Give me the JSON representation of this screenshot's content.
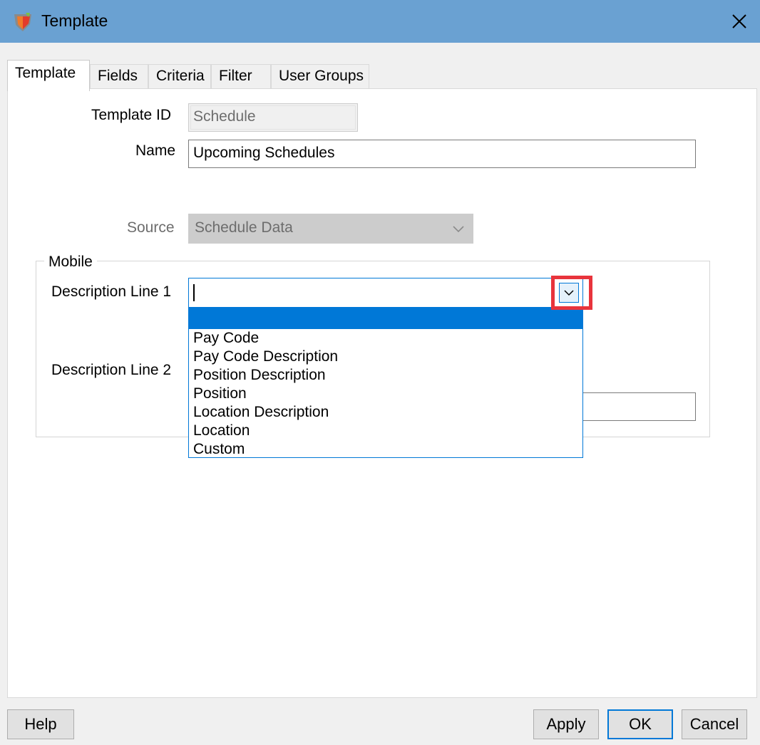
{
  "window": {
    "title": "Template",
    "icon": "app-shield-icon",
    "close_icon": "close-icon"
  },
  "tabs": [
    {
      "label": "Template",
      "active": true
    },
    {
      "label": "Fields",
      "active": false
    },
    {
      "label": "Criteria",
      "active": false
    },
    {
      "label": "Filter",
      "active": false
    },
    {
      "label": "User Groups",
      "active": false
    }
  ],
  "form": {
    "template_id": {
      "label": "Template ID",
      "value": "Schedule"
    },
    "name": {
      "label": "Name",
      "value": "Upcoming Schedules"
    },
    "source": {
      "label": "Source",
      "value": "Schedule Data"
    }
  },
  "mobile": {
    "group_label": "Mobile",
    "description_line_1": {
      "label": "Description Line 1",
      "value": ""
    },
    "description_line_2": {
      "label": "Description Line 2",
      "value": ""
    },
    "dropdown_options": [
      "",
      "Pay Code",
      "Pay Code Description",
      "Position Description",
      "Position",
      "Location Description",
      "Location",
      "Custom"
    ]
  },
  "buttons": {
    "help": "Help",
    "apply": "Apply",
    "ok": "OK",
    "cancel": "Cancel"
  },
  "colors": {
    "titlebar": "#6aa1d2",
    "accent": "#0078d7",
    "highlight": "#e8343c"
  }
}
